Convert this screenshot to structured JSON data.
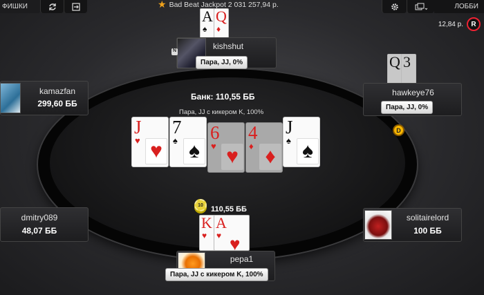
{
  "topbar": {
    "chips_label": "ФИШКИ",
    "jackpot_text": "Bad Beat Jackpot  2 031 257,94 р.",
    "lobby_label": "ЛОББИ",
    "balance": "12,84 р.",
    "rewards_badge": "R"
  },
  "table": {
    "pot": "Банк: 110,55 ББ",
    "hand_description": "Пара, JJ с кикером K, 100%",
    "bet": "110,55 ББ",
    "chip_value": "10",
    "dealer_button": "D",
    "board": [
      {
        "rank": "J",
        "suit": "♥",
        "color": "red",
        "dim": false
      },
      {
        "rank": "7",
        "suit": "♠",
        "color": "black",
        "dim": false
      },
      {
        "rank": "6",
        "suit": "♥",
        "color": "red",
        "dim": true
      },
      {
        "rank": "4",
        "suit": "♦",
        "color": "red",
        "dim": true
      },
      {
        "rank": "J",
        "suit": "♠",
        "color": "black",
        "dim": false
      }
    ]
  },
  "players": {
    "kishshut": {
      "name": "kishshut",
      "hand": "Пара, JJ, 0%",
      "cards": [
        "A",
        "Q"
      ],
      "badge": "N"
    },
    "kamazfan": {
      "name": "kamazfan",
      "stack": "299,60 ББ"
    },
    "hawkeye76": {
      "name": "hawkeye76",
      "hand": "Пара, JJ, 0%",
      "cards": [
        "Q",
        "3"
      ]
    },
    "dmitry089": {
      "name": "dmitry089",
      "stack": "48,07 ББ"
    },
    "solitairelord": {
      "name": "solitairelord",
      "stack": "100 ББ"
    },
    "pepa1": {
      "name": "pepa1",
      "hand": "Пара, JJ с кикером K, 100%",
      "cards": [
        "K",
        "A"
      ]
    }
  },
  "colors": {
    "card_red": "#d9201f",
    "dealer": "#f7b600",
    "jackpot_star": "#f0a21b"
  }
}
